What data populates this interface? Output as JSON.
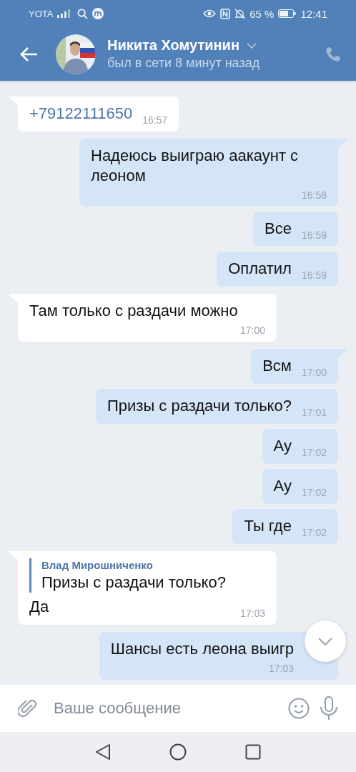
{
  "status_bar": {
    "carrier": "YOTA",
    "battery": "65 %",
    "time": "12:41"
  },
  "header": {
    "name": "Никита Хомутинин",
    "status": "был в сети 8 минут назад"
  },
  "messages": [
    {
      "outgoing": false,
      "kind": "link",
      "text": "+79122111650",
      "time": "16:57"
    },
    {
      "outgoing": true,
      "kind": "text",
      "text": "Надеюсь выиграю аакаунт с леоном",
      "time": "16:58"
    },
    {
      "outgoing": true,
      "kind": "text",
      "text": "Все",
      "time": "16:59"
    },
    {
      "outgoing": true,
      "kind": "text",
      "text": "Оплатил",
      "time": "16:59"
    },
    {
      "outgoing": false,
      "kind": "text",
      "text": "Там только с раздачи можно",
      "time": "17:00"
    },
    {
      "outgoing": true,
      "kind": "text",
      "text": "Всм",
      "time": "17:00"
    },
    {
      "outgoing": true,
      "kind": "text",
      "text": "Призы с раздачи только?",
      "time": "17:01"
    },
    {
      "outgoing": true,
      "kind": "text",
      "text": "Ау",
      "time": "17:02"
    },
    {
      "outgoing": true,
      "kind": "text",
      "text": "Ау",
      "time": "17:02"
    },
    {
      "outgoing": true,
      "kind": "text",
      "text": "Ты где",
      "time": "17:02"
    },
    {
      "outgoing": false,
      "kind": "reply",
      "quote_author": "Влад Мирошниченко",
      "quote_text": "Призы с раздачи только?",
      "text": "Да",
      "time": "17:03"
    },
    {
      "outgoing": true,
      "kind": "text",
      "text": "Шансы есть леона выигр",
      "time": "17:03"
    }
  ],
  "composer": {
    "placeholder": "Ваше сообщение"
  }
}
